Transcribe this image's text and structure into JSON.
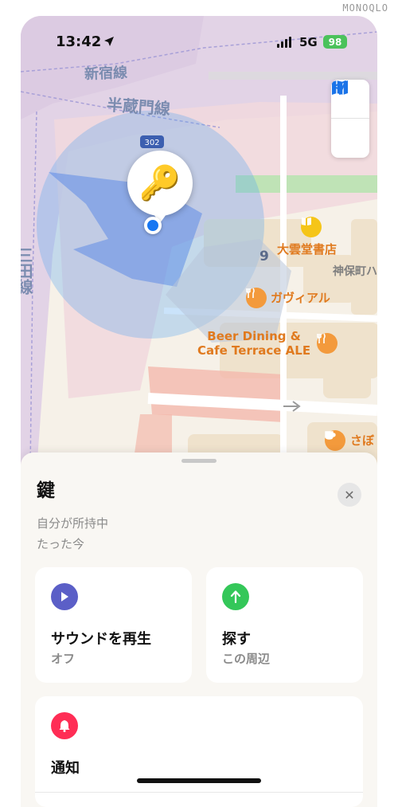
{
  "watermark": "MONOQLO",
  "status_bar": {
    "time": "13:42",
    "network": "5G",
    "battery": "98"
  },
  "map": {
    "line_labels": [
      "新宿線",
      "半蔵門線",
      "三田線"
    ],
    "route_shield": "302",
    "street_number": "9",
    "area_label": "神保町ハ",
    "pois": [
      {
        "name": "大雲堂書店",
        "icon": "book-icon"
      },
      {
        "name": "ガヴィアル",
        "icon": "fork-knife-icon"
      },
      {
        "name": "Beer Dining &",
        "name2": "Cafe Terrace ALE",
        "icon": "fork-knife-icon"
      },
      {
        "name": "さぼ",
        "icon": "coffee-cup-icon"
      }
    ],
    "controls": [
      "map-icon",
      "location-arrow-icon"
    ],
    "accuracy_color": "#5aa9ef",
    "item_icon": "key-icon"
  },
  "sheet": {
    "title": "鍵",
    "subtitle": "自分が所持中",
    "updated": "たった今",
    "actions": [
      {
        "label": "サウンドを再生",
        "sub": "オフ",
        "icon": "play-icon",
        "color": "#5b5fc7"
      },
      {
        "label": "探す",
        "sub": "この周辺",
        "icon": "arrow-up-icon",
        "color": "#34c759"
      },
      {
        "label": "通知",
        "icon": "bell-icon",
        "color": "#ff2d55"
      }
    ]
  }
}
